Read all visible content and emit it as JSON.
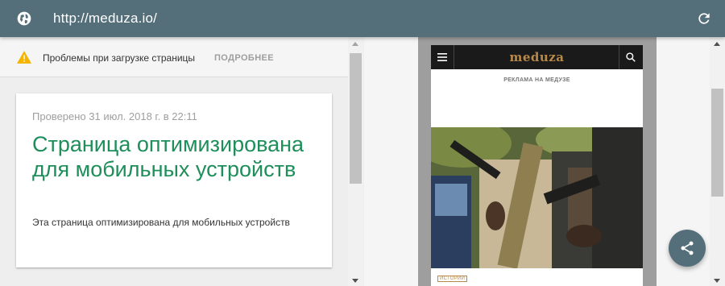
{
  "urlbar": {
    "url": "http://meduza.io/",
    "left_icon": "globe-icon",
    "right_icon": "reload-icon",
    "color": "#546e7a"
  },
  "warning": {
    "icon": "warning-icon",
    "text": "Проблемы при загрузке страницы",
    "more_label": "ПОДРОБНЕЕ"
  },
  "result_card": {
    "checked_text": "Проверено 31 июл. 2018 г. в 22:11",
    "title": "Страница оптимизирована для мобильных устройств",
    "description": "Эта страница оптимизирована для мобильных устройств",
    "title_color": "#1e8e5a"
  },
  "preview": {
    "logo": "meduza",
    "ad_label": "РЕКЛАМА НА МЕДУЗЕ",
    "tag": "ИСТОРИИ",
    "menu_icon": "menu-icon",
    "search_icon": "search-icon",
    "accent_color": "#b88a4a"
  },
  "fab": {
    "icon": "share-icon"
  }
}
